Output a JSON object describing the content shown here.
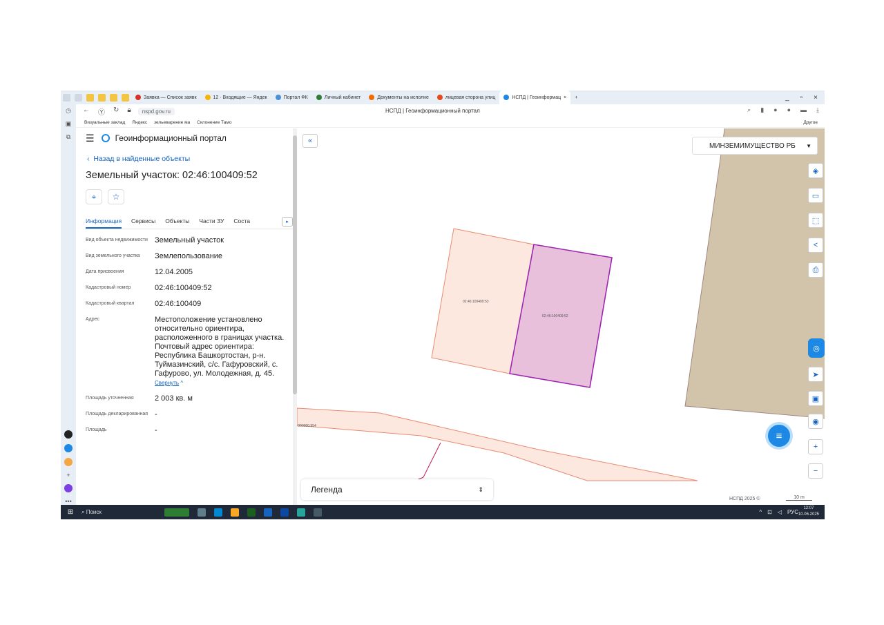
{
  "browser": {
    "tabs": [
      {
        "label": "Заявка — Список заявк",
        "color": "#d93025"
      },
      {
        "label": "12 · Входящие — Яндек",
        "color": "#f4b400"
      },
      {
        "label": "Портал ФК",
        "color": "#4a90d9"
      },
      {
        "label": "Личный кабинет",
        "color": "#2e7d32"
      },
      {
        "label": "Документы на исполне",
        "color": "#ef6c00"
      },
      {
        "label": "лицевая сторона улиц",
        "color": "#e64a19"
      },
      {
        "label": "НСПД | Геоинформац",
        "color": "#1e88e5",
        "active": true
      }
    ],
    "url": "nspd.gov.ru",
    "page_title": "НСПД | Геоинформационный портал",
    "bookmarks": [
      "Визуальные заклад",
      "Яндекс",
      "зельеварение ма",
      "Склонение Тамо"
    ],
    "bookmarks_other": "Другое"
  },
  "portal": {
    "name": "Геоинформационный портал",
    "back_label": "Назад в найденные объекты",
    "title": "Земельный участок: 02:46:100409:52",
    "tabs": [
      "Информация",
      "Сервисы",
      "Объекты",
      "Части ЗУ",
      "Соста"
    ],
    "fields": [
      {
        "key": "Вид объекта недвижимости",
        "value": "Земельный участок"
      },
      {
        "key": "Вид земельного участка",
        "value": "Землепользование"
      },
      {
        "key": "Дата присвоения",
        "value": "12.04.2005"
      },
      {
        "key": "Кадастровый номер",
        "value": "02:46:100409:52"
      },
      {
        "key": "Кадастровый квартал",
        "value": "02:46:100409"
      },
      {
        "key": "Адрес",
        "value": "Местоположение установлено относительно ориентира, расположенного в границах участка. Почтовый адрес ориентира: Республика Башкортостан, р-н. Туймазинский, с/с. Гафуровский, с. Гафурово, ул. Молодежная, д. 45."
      },
      {
        "key": "Площадь уточненная",
        "value": "2 003 кв. м"
      },
      {
        "key": "Площадь декларированная",
        "value": "-"
      },
      {
        "key": "Площадь",
        "value": "-"
      }
    ],
    "collapse_link": "Свернуть"
  },
  "map": {
    "org_select": "МИНЗЕМИМУЩЕСТВО РБ",
    "parcel_labels": [
      "02:46:100409:53",
      "02:46:100409:52"
    ],
    "edge_label": ":000000:954",
    "legend": "Легенда",
    "footer": "НСПД 2025 ©",
    "scale": "10 m"
  },
  "taskbar": {
    "search": "Поиск",
    "lang": "РУС",
    "time": "12:07",
    "date": "10.06.2025"
  }
}
